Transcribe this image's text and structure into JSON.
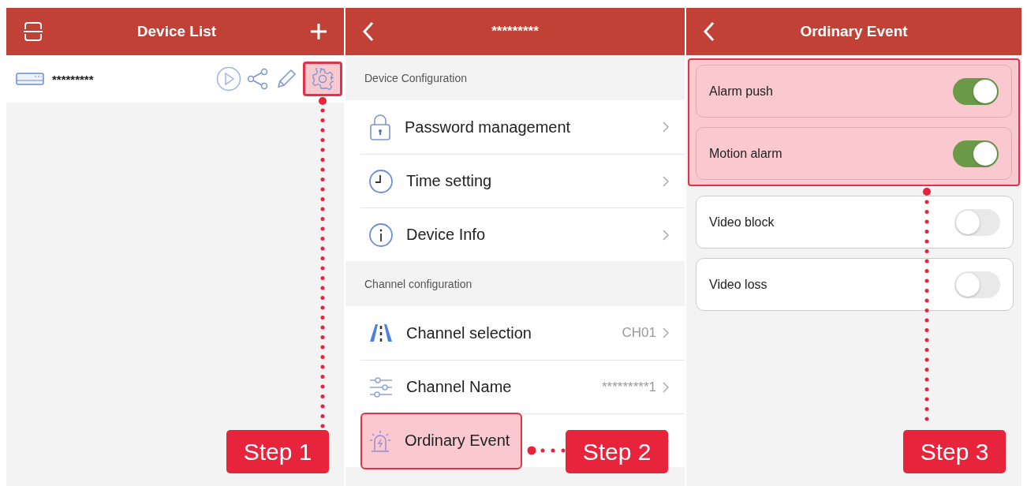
{
  "device_list": {
    "title": "Device List",
    "devices": [
      {
        "name": "*********",
        "settings_selected": true
      }
    ]
  },
  "device_settings": {
    "title": "*********",
    "sections": [
      {
        "heading": "Device Configuration",
        "items": [
          {
            "label": "Password management",
            "highlighted": false
          },
          {
            "label": "Time setting",
            "highlighted": false
          },
          {
            "label": "Device Info",
            "highlighted": false
          }
        ]
      },
      {
        "heading": "Channel configuration",
        "items": [
          {
            "label": "Channel selection",
            "value": "CH01",
            "highlighted": false
          },
          {
            "label": "Channel Name",
            "value": "*********1",
            "highlighted": false
          },
          {
            "label": "Ordinary Event",
            "highlighted": true
          }
        ]
      }
    ]
  },
  "ordinary_event": {
    "title": "Ordinary Event",
    "events": [
      {
        "label": "Alarm push",
        "on": true,
        "highlighted": true
      },
      {
        "label": "Motion alarm",
        "on": true,
        "highlighted": true
      },
      {
        "label": "Video block",
        "on": false,
        "highlighted": false
      },
      {
        "label": "Video loss",
        "on": false,
        "highlighted": false
      }
    ]
  },
  "steps": [
    {
      "label": "Step 1"
    },
    {
      "label": "Step 2"
    },
    {
      "label": "Step 3"
    }
  ]
}
